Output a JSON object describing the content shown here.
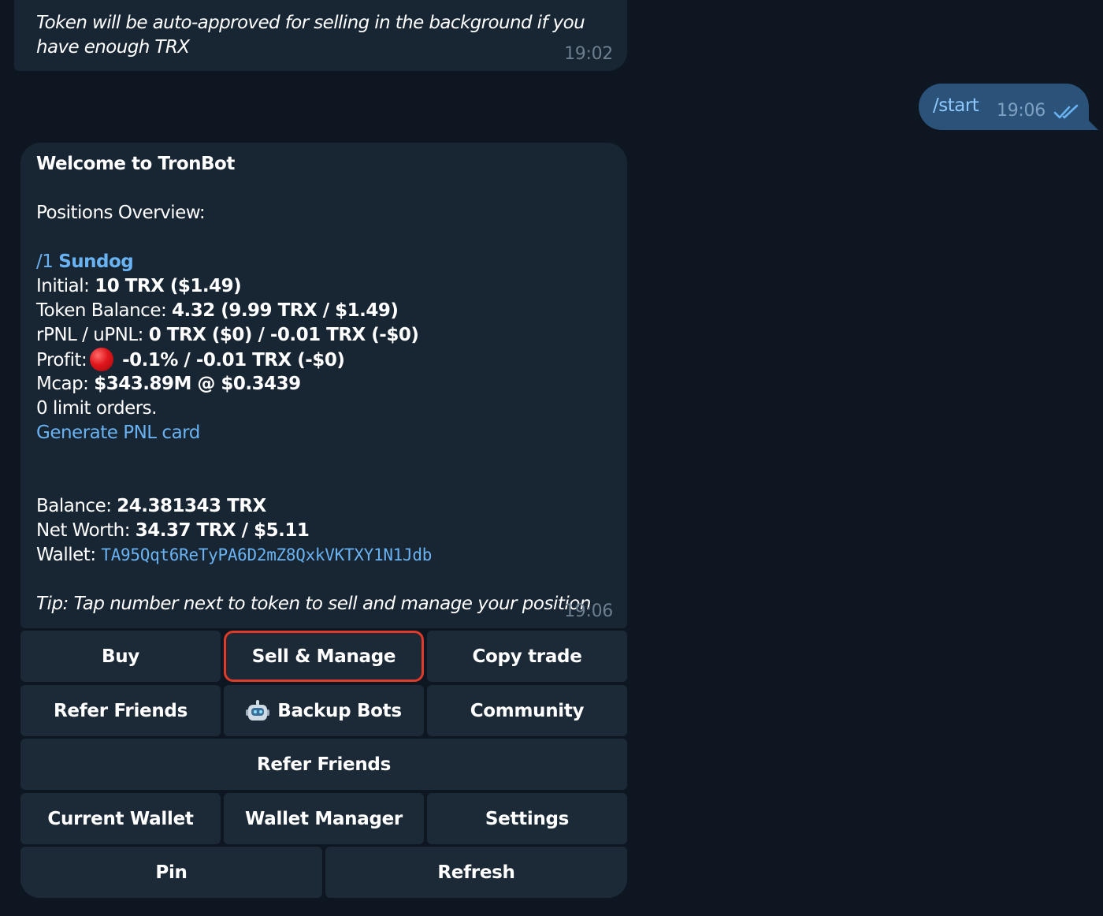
{
  "previous_message": {
    "text": "Token will be auto-approved for selling in the background if you have enough TRX",
    "time": "19:02"
  },
  "outgoing_message": {
    "text": "/start",
    "time": "19:06",
    "status": "read"
  },
  "bot_message": {
    "title": "Welcome to TronBot",
    "section_heading": "Positions Overview:",
    "position": {
      "index_link": "/1",
      "token_name": "Sundog",
      "initial_label": "Initial:",
      "initial_value": "10 TRX ($1.49)",
      "token_balance_label": "Token Balance:",
      "token_balance_value": "4.32 (9.99 TRX / $1.49)",
      "pnl_label": "rPNL / uPNL:",
      "pnl_value": "0 TRX ($0) / -0.01 TRX (-$0)",
      "profit_label": "Profit:",
      "profit_value": "-0.1% / -0.01 TRX (-$0)",
      "mcap_label": "Mcap:",
      "mcap_value": "$343.89M @ $0.3439",
      "limit_orders": "0 limit orders.",
      "pnl_card_link": "Generate PNL card"
    },
    "balance_label": "Balance:",
    "balance_value": "24.381343 TRX",
    "net_worth_label": "Net Worth:",
    "net_worth_value": "34.37 TRX / $5.11",
    "wallet_label": "Wallet:",
    "wallet_address": "TA95Qqt6ReTyPA6D2mZ8QxkVKTXY1N1Jdb",
    "tip": "Tip: Tap number next to token to sell and manage your position",
    "time": "19:06"
  },
  "keyboard": {
    "buy": "Buy",
    "sell_manage": "Sell & Manage",
    "copy_trade": "Copy trade",
    "refer_friends": "Refer Friends",
    "backup_bots": "Backup Bots",
    "community": "Community",
    "refer_friends_wide": "Refer Friends",
    "current_wallet": "Current Wallet",
    "wallet_manager": "Wallet Manager",
    "settings": "Settings",
    "pin": "Pin",
    "refresh": "Refresh"
  },
  "colors": {
    "background": "#0e1621",
    "incoming_bubble": "#182533",
    "outgoing_bubble": "#2b5278",
    "link": "#6ab3f3",
    "highlight": "#e03a29"
  }
}
